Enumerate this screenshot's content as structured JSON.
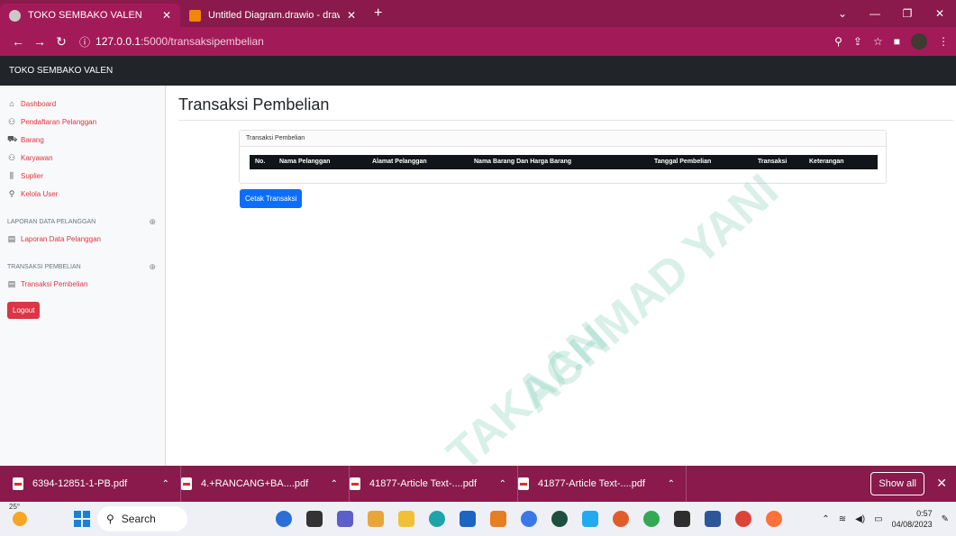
{
  "browser": {
    "tabs": [
      {
        "title": "TOKO SEMBAKO VALEN",
        "active": true
      },
      {
        "title": "Untitled Diagram.drawio - draw.i",
        "active": false
      }
    ],
    "url_host": "127.0.0.1",
    "url_path": ":5000/transaksipembelian"
  },
  "app": {
    "brand": "TOKO SEMBAKO VALEN"
  },
  "sidebar": {
    "items": [
      {
        "label": "Dashboard",
        "icon": "house-icon"
      },
      {
        "label": "Pendaftaran Pelanggan",
        "icon": "users-icon"
      },
      {
        "label": "Barang",
        "icon": "cart-icon"
      },
      {
        "label": "Karyawan",
        "icon": "users-icon"
      },
      {
        "label": "Suplier",
        "icon": "chart-icon"
      },
      {
        "label": "Kelola User",
        "icon": "user-icon"
      }
    ],
    "section_laporan": {
      "heading": "LAPORAN DATA PELANGGAN",
      "item": "Laporan Data Pelanggan"
    },
    "section_transaksi": {
      "heading": "TRANSAKSI PEMBELIAN",
      "item": "Transaksi Pembelian"
    },
    "logout_label": "Logout"
  },
  "main": {
    "title": "Transaksi Pembelian",
    "card_header": "Transaksi Pembelian",
    "columns": [
      "No.",
      "Nama Pelanggan",
      "Alamat Pelanggan",
      "Nama Barang Dan Harga Barang",
      "Tanggal Pembelian",
      "Transaksi",
      "Keterangan"
    ],
    "cetak_label": "Cetak Transaksi"
  },
  "watermark": {
    "line1": "ACHMAD YANI",
    "line2": "TAKAAN"
  },
  "downloads": {
    "files": [
      "6394-12851-1-PB.pdf",
      "4.+RANCANG+BA....pdf",
      "41877-Article Text-....pdf",
      "41877-Article Text-....pdf"
    ],
    "show_all": "Show all"
  },
  "taskbar": {
    "temperature": "25°",
    "search_label": "Search",
    "time": "0:57",
    "date": "04/08/2023"
  }
}
